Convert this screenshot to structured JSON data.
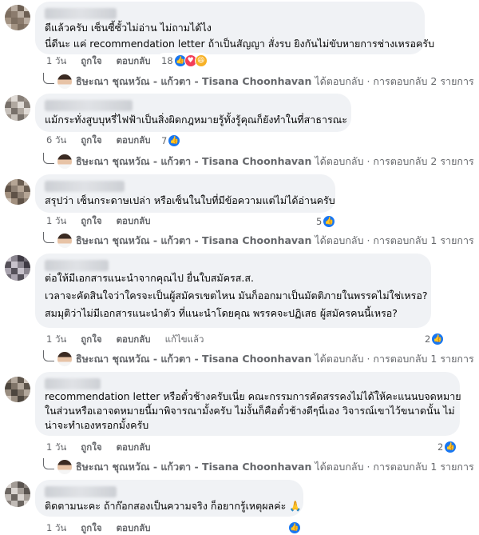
{
  "comments": [
    {
      "lines": [
        "ดีแล้วครับ เซ็นซี้ซั้วไม่อ่าน ไม่ถามได้ไง",
        "นี่ดีนะ แค่ recommendation letter ถ้าเป็นสัญญา สั่งรบ ยิงกันไม่ขับหายการช่างเหรอครับ"
      ],
      "time": "1 วัน",
      "like": "ถูกใจ",
      "reply": "ตอบกลับ",
      "edited": "",
      "reactions_count": "18",
      "reactions": [
        "like-icon",
        "love-icon",
        "haha-icon"
      ],
      "reply_author": "ธิษะณา ชุณหวัณ - แก้วตา - Tisana Choonhavan",
      "reply_action": "ได้ตอบกลับ · การตอบกลับ 2 รายการ"
    },
    {
      "lines": [
        "แม้กระทั่งสูบบุหรี่ไฟฟ้าเป็นสิ่งผิดกฎหมายรู้ทั้งรู้คุณก็ยังทำในที่สาธารณะ"
      ],
      "time": "6 วัน",
      "like": "ถูกใจ",
      "reply": "ตอบกลับ",
      "edited": "",
      "reactions_count": "7",
      "reactions": [
        "like-icon"
      ],
      "reply_author": "ธิษะณา ชุณหวัณ - แก้วตา - Tisana Choonhavan",
      "reply_action": "ได้ตอบกลับ · การตอบกลับ 2 รายการ"
    },
    {
      "lines": [
        "สรุปว่า เซ็นกระดาษเปล่า หรือเซ็นในใบที่มีข้อความแต่ไม่ได้อ่านครับ"
      ],
      "time": "1 วัน",
      "like": "ถูกใจ",
      "reply": "ตอบกลับ",
      "edited": "",
      "reactions_count": "5",
      "reactions": [
        "like-icon"
      ],
      "reply_author": "ธิษะณา ชุณหวัณ - แก้วตา - Tisana Choonhavan",
      "reply_action": "ได้ตอบกลับ · การตอบกลับ 1 รายการ"
    },
    {
      "lines": [
        "ต่อให้มีเอกสารแนะนำจากคุณไป ยื่นใบสมัครส.ส.",
        "",
        "เวลาจะคัดสินใจว่าใครจะเป็นผู้สมัครเขตไหน มันก็ออกมาเป็นมัตติภายในพรรคไม่ใช่เหรอ?",
        "",
        "สมมุติว่าไม่มีเอกสารแนะนำตัว ที่แนะนำโดยคุณ พรรคจะปฏิเสธ ผู้สมัครคนนี้เหรอ?"
      ],
      "time": "1 วัน",
      "like": "ถูกใจ",
      "reply": "ตอบกลับ",
      "edited": "แก้ไขแล้ว",
      "reactions_count": "2",
      "reactions": [
        "like-icon"
      ],
      "reply_author": "ธิษะณา ชุณหวัณ - แก้วตา - Tisana Choonhavan",
      "reply_action": "ได้ตอบกลับ · การตอบกลับ 1 รายการ"
    },
    {
      "lines": [
        "recommendation letter หรือตั๋วช้างครับเนี่ย คณะกรรมการคัดสรรคงไม่ได้ให้คะแนนบจดหมาย",
        "ในส่วนหรือเอาจดหมายนี้มาพิจารณามั้งครับ ไม่งั้นก็คือตั๋วช้างดีๆนี่เอง วิจารณ์เขาไว้ขนาดนั้น ไม่",
        "น่าจะทำเองหรอกมั้งครับ"
      ],
      "time": "1 วัน",
      "like": "ถูกใจ",
      "reply": "ตอบกลับ",
      "edited": "",
      "reactions_count": "2",
      "reactions": [
        "like-icon"
      ],
      "reply_author": "ธิษะณา ชุณหวัณ - แก้วตา - Tisana Choonhavan",
      "reply_action": "ได้ตอบกลับ · การตอบกลับ 1 รายการ"
    },
    {
      "lines": [
        "ติดตามนะคะ ถ้าก๊อกสองเป็นความจริง ก็อยากรู้เหตุผลค่ะ 🙏"
      ],
      "time": "1 วัน",
      "like": "ถูกใจ",
      "reply": "ตอบกลับ",
      "edited": "",
      "reactions_count": "",
      "reactions": [
        "like-icon"
      ],
      "reply_author": "",
      "reply_action": ""
    }
  ],
  "colors": {
    "bubble": "#f0f2f5",
    "secondary_text": "#65676b",
    "like_blue": "#1877f2"
  }
}
